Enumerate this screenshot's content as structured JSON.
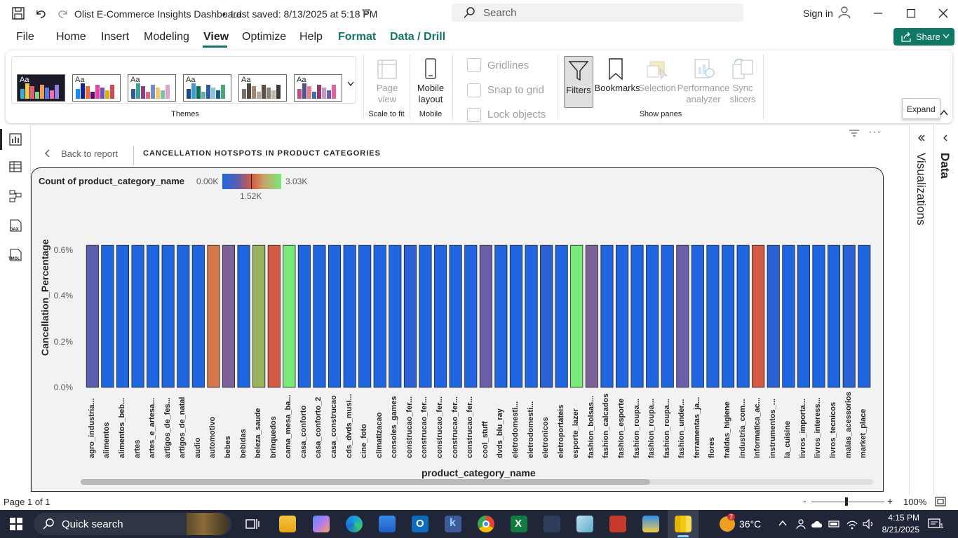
{
  "titlebar": {
    "doc_title": "Olist E-Commerce Insights Dashboard",
    "saved": "Last saved: 8/13/2025 at 5:18 PM",
    "search_placeholder": "Search",
    "sign_in": "Sign in"
  },
  "menu": {
    "file": "File",
    "home": "Home",
    "insert": "Insert",
    "modeling": "Modeling",
    "view": "View",
    "optimize": "Optimize",
    "help": "Help",
    "format": "Format",
    "data_drill": "Data / Drill",
    "share": "Share"
  },
  "ribbon": {
    "themes_label": "Themes",
    "theme_aa": "Aa",
    "page_view": "Page view",
    "scale_to_fit": "Scale to fit",
    "mobile_layout": "Mobile layout",
    "mobile": "Mobile",
    "gridlines": "Gridlines",
    "snap_to_grid": "Snap to grid",
    "lock_objects": "Lock objects",
    "filters": "Filters",
    "bookmarks": "Bookmarks",
    "selection": "Selection",
    "performance_analyzer": "Performance analyzer",
    "sync_slicers": "Sync slicers",
    "show_panes": "Show panes",
    "expand_tooltip": "Expand"
  },
  "report": {
    "back_to_report": "Back to report",
    "page_title": "CANCELLATION HOTSPOTS IN PRODUCT CATEGORIES",
    "legend_title": "Count of product_category_name",
    "legend_min": "0.00K",
    "legend_mid": "1.52K",
    "legend_max": "3.03K"
  },
  "panes": {
    "visualizations": "Visualizations",
    "data": "Data"
  },
  "status": {
    "page": "Page 1 of 1",
    "zoom": "100%"
  },
  "taskbar": {
    "quick_search": "Quick search",
    "weather": "36°C",
    "weather_badge": "7",
    "time": "4:15 PM",
    "date": "8/21/2025",
    "notifications": "1"
  },
  "colors": {
    "accent_green": "#117865",
    "bar_blue": "#1f66e0",
    "bar_purple": "#6a5ea8",
    "bar_orange": "#d4784b",
    "bar_red": "#d45b43",
    "bar_green": "#79ea7a",
    "bar_olive": "#9ab35e",
    "bar_mauve": "#7e6197"
  },
  "chart_data": {
    "type": "bar",
    "title": "",
    "xlabel": "product_category_name",
    "ylabel": "Cancellation_Percentage",
    "yticks": [
      "0.0%",
      "0.2%",
      "0.4%",
      "0.6%"
    ],
    "ylim": [
      0,
      0.007
    ],
    "grid": false,
    "color_encoding": "Count of product_category_name (0.00K blue → 1.52K red → 3.03K green)",
    "categories": [
      "agro_industria...",
      "alimentos",
      "alimentos_beb...",
      "artes",
      "artes_e_artesa...",
      "artigos_de_fes...",
      "artigos_de_natal",
      "audio",
      "automotivo",
      "bebes",
      "bebidas",
      "beleza_saude",
      "brinquedos",
      "cama_mesa_ba...",
      "casa_conforto",
      "casa_conforto_2",
      "casa_construcao",
      "cds_dvds_musi...",
      "cine_foto",
      "climatizacao",
      "consoles_games",
      "construcao_fer...",
      "construcao_fer...",
      "construcao_fer...",
      "construcao_fer...",
      "construcao_fer...",
      "cool_stuff",
      "dvds_blu_ray",
      "eletrodomesti...",
      "eletrodomesti...",
      "eletronicos",
      "eletroportateis",
      "esporte_lazer",
      "fashion_bolsas...",
      "fashion_calcados",
      "fashion_esporte",
      "fashion_roupa...",
      "fashion_roupa...",
      "fashion_roupa...",
      "fashion_under...",
      "ferramentas_ja...",
      "flores",
      "fraldas_higiene",
      "industria_com...",
      "informatica_ac...",
      "instrumentos_...",
      "la_cuisine",
      "livros_importa...",
      "livros_interess...",
      "livros_tecnicos",
      "malas_acessorios",
      "market_place"
    ],
    "values": [
      0.0062,
      0.0062,
      0.0062,
      0.0062,
      0.0062,
      0.0062,
      0.0062,
      0.0062,
      0.0062,
      0.0062,
      0.0062,
      0.0062,
      0.0062,
      0.0062,
      0.0062,
      0.0062,
      0.0062,
      0.0062,
      0.0062,
      0.0062,
      0.0062,
      0.0062,
      0.0062,
      0.0062,
      0.0062,
      0.0062,
      0.0062,
      0.0062,
      0.0062,
      0.0062,
      0.0062,
      0.0062,
      0.0062,
      0.0062,
      0.0062,
      0.0062,
      0.0062,
      0.0062,
      0.0062,
      0.0062,
      0.0062,
      0.0062,
      0.0062,
      0.0062,
      0.0062,
      0.0062,
      0.0062,
      0.0062,
      0.0062,
      0.0062,
      0.0062,
      0.0062
    ],
    "bar_colors": [
      "#5a5fae",
      "#1f66e0",
      "#1f66e0",
      "#1f66e0",
      "#1f66e0",
      "#1f66e0",
      "#1f66e0",
      "#1f66e0",
      "#d4784b",
      "#7e6197",
      "#1f66e0",
      "#9ab35e",
      "#d45b43",
      "#79ea7a",
      "#1f66e0",
      "#1f66e0",
      "#1f66e0",
      "#1f66e0",
      "#1f66e0",
      "#1f66e0",
      "#1f66e0",
      "#2b62d3",
      "#1f66e0",
      "#1f66e0",
      "#1f66e0",
      "#1f66e0",
      "#6a5ea8",
      "#1f66e0",
      "#1f66e0",
      "#1f66e0",
      "#2b62d3",
      "#1f66e0",
      "#79ea7a",
      "#7e6197",
      "#1f66e0",
      "#1f66e0",
      "#1f66e0",
      "#1f66e0",
      "#1f66e0",
      "#6a5ea8",
      "#1f66e0",
      "#1f66e0",
      "#1f66e0",
      "#1f66e0",
      "#d45b43",
      "#2b62d3",
      "#1f66e0",
      "#1f66e0",
      "#1f66e0",
      "#1f66e0",
      "#2b62d3",
      "#1f66e0"
    ]
  }
}
